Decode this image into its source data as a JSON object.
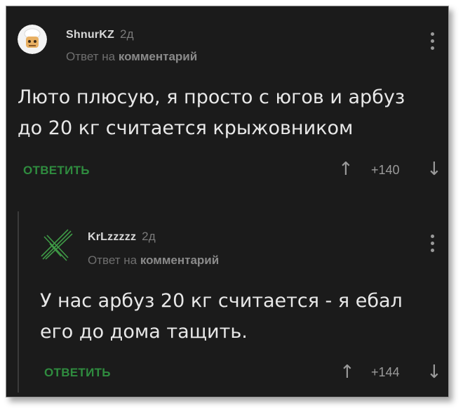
{
  "comments": [
    {
      "username": "ShnurKZ",
      "time": "2д",
      "reply_prefix": "Ответ на",
      "reply_target": "комментарий",
      "text_line1": "Люто плюсую, я просто с югов и арбуз",
      "text_line2": "до 20 кг считается крыжовником",
      "reply_label": "ОТВЕТИТЬ",
      "rating": "+140",
      "upvote_icon": "↑",
      "downvote_icon": "↓"
    },
    {
      "username": "KrLzzzzz",
      "time": "2д",
      "reply_prefix": "Ответ на",
      "reply_target": "комментарий",
      "text_line1": "У нас арбуз 20 кг считается - я ебал",
      "text_line2": "его до дома тащить.",
      "reply_label": "ОТВЕТИТЬ",
      "rating": "+144",
      "upvote_icon": "↑",
      "downvote_icon": "↓"
    }
  ],
  "colors": {
    "background": "#1b1b1b",
    "accent_green": "#2f8c3f",
    "text": "#e8e8e8",
    "muted": "#7b7b7b"
  }
}
